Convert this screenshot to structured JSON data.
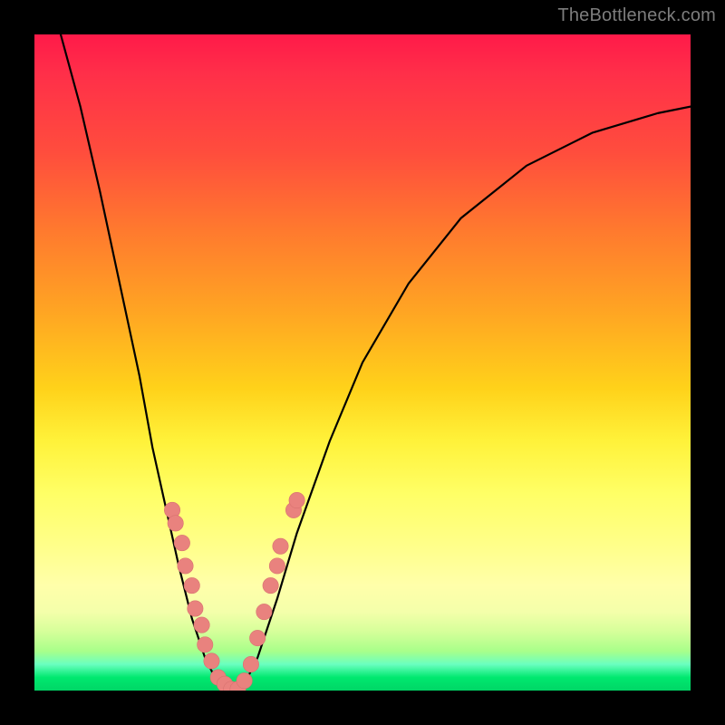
{
  "watermark": "TheBottleneck.com",
  "colors": {
    "frame_bg": "#000000",
    "curve_stroke": "#000000",
    "bead_fill": "#e9827e",
    "bead_stroke": "#d87270",
    "gradient_top": "#ff1a49",
    "gradient_mid": "#ffff66",
    "gradient_bottom": "#00d666"
  },
  "chart_data": {
    "type": "line",
    "title": "",
    "xlabel": "",
    "ylabel": "",
    "xlim": [
      0,
      100
    ],
    "ylim": [
      0,
      100
    ],
    "grid": false,
    "legend": false,
    "note": "V-shaped bottleneck curve. y≈100 means high bottleneck (red, top); y≈0 means optimal (green, bottom). Axis values are estimated from pixel positions.",
    "series": [
      {
        "name": "bottleneck-curve",
        "points": [
          {
            "x": 4,
            "y": 100
          },
          {
            "x": 7,
            "y": 89
          },
          {
            "x": 10,
            "y": 76
          },
          {
            "x": 13,
            "y": 62
          },
          {
            "x": 16,
            "y": 48
          },
          {
            "x": 18,
            "y": 37
          },
          {
            "x": 20,
            "y": 28
          },
          {
            "x": 22,
            "y": 19
          },
          {
            "x": 24,
            "y": 11
          },
          {
            "x": 26,
            "y": 5
          },
          {
            "x": 28,
            "y": 1
          },
          {
            "x": 30,
            "y": 0
          },
          {
            "x": 32,
            "y": 1
          },
          {
            "x": 34,
            "y": 5
          },
          {
            "x": 37,
            "y": 14
          },
          {
            "x": 40,
            "y": 24
          },
          {
            "x": 45,
            "y": 38
          },
          {
            "x": 50,
            "y": 50
          },
          {
            "x": 57,
            "y": 62
          },
          {
            "x": 65,
            "y": 72
          },
          {
            "x": 75,
            "y": 80
          },
          {
            "x": 85,
            "y": 85
          },
          {
            "x": 95,
            "y": 88
          },
          {
            "x": 100,
            "y": 89
          }
        ]
      }
    ],
    "markers": [
      {
        "x": 21.0,
        "y": 27.5
      },
      {
        "x": 21.5,
        "y": 25.5
      },
      {
        "x": 22.5,
        "y": 22.5
      },
      {
        "x": 23.0,
        "y": 19.0
      },
      {
        "x": 24.0,
        "y": 16.0
      },
      {
        "x": 24.5,
        "y": 12.5
      },
      {
        "x": 25.5,
        "y": 10.0
      },
      {
        "x": 26.0,
        "y": 7.0
      },
      {
        "x": 27.0,
        "y": 4.5
      },
      {
        "x": 28.0,
        "y": 2.0
      },
      {
        "x": 29.0,
        "y": 1.0
      },
      {
        "x": 30.0,
        "y": 0.2
      },
      {
        "x": 31.0,
        "y": 0.2
      },
      {
        "x": 32.0,
        "y": 1.5
      },
      {
        "x": 33.0,
        "y": 4.0
      },
      {
        "x": 34.0,
        "y": 8.0
      },
      {
        "x": 35.0,
        "y": 12.0
      },
      {
        "x": 36.0,
        "y": 16.0
      },
      {
        "x": 37.0,
        "y": 19.0
      },
      {
        "x": 37.5,
        "y": 22.0
      },
      {
        "x": 39.5,
        "y": 27.5
      },
      {
        "x": 40.0,
        "y": 29.0
      }
    ],
    "marker_radius_data_units": 1.2
  }
}
